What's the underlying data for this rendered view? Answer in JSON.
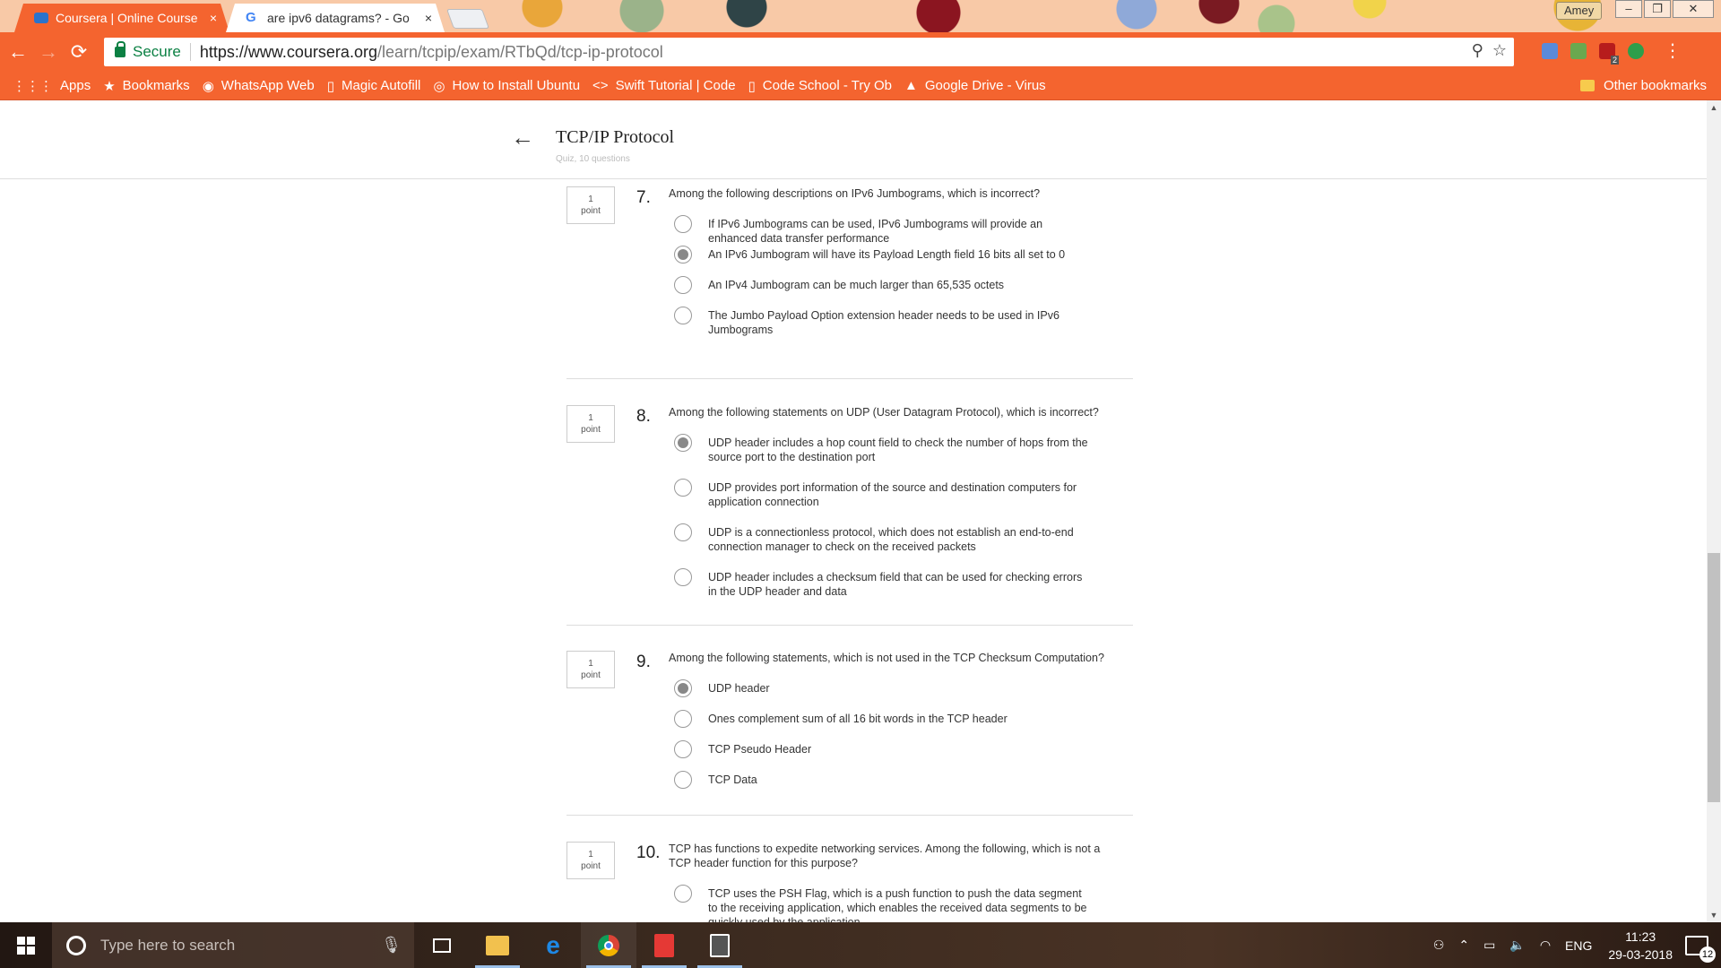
{
  "browser": {
    "tabs": [
      {
        "title": "Coursera | Online Course",
        "close": "×"
      },
      {
        "title": "are ipv6 datagrams? - Go",
        "close": "×",
        "favicon": "G"
      }
    ],
    "profile": "Amey",
    "window_buttons": {
      "minimize": "–",
      "maximize": "❐",
      "close": "✕"
    },
    "nav": {
      "back": "←",
      "forward": "→",
      "reload": "⟳"
    },
    "secure_label": "Secure",
    "url_host": "https://www.coursera.org",
    "url_path": "/learn/tcpip/exam/RTbQd/tcp-ip-protocol",
    "omni_icons": {
      "zoom": "⚲",
      "star": "☆"
    },
    "menu": "⋮",
    "ext_badge": "2",
    "bookmarks": [
      {
        "label": "Apps",
        "icon": "⋮⋮⋮"
      },
      {
        "label": "Bookmarks",
        "icon": "★"
      },
      {
        "label": "WhatsApp Web",
        "icon": "◉"
      },
      {
        "label": "Magic Autofill",
        "icon": "▯"
      },
      {
        "label": "How to Install Ubuntu",
        "icon": "◎"
      },
      {
        "label": "Swift Tutorial | Code",
        "icon": "<>"
      },
      {
        "label": "Code School - Try Ob",
        "icon": "▯"
      },
      {
        "label": "Google Drive - Virus",
        "icon": "▲"
      }
    ],
    "other_bookmarks": "Other bookmarks"
  },
  "page": {
    "back_icon": "←",
    "title": "TCP/IP Protocol",
    "subtitle": "Quiz, 10 questions",
    "questions": [
      {
        "points": [
          "1",
          "point"
        ],
        "number": "7.",
        "text": "Among the following descriptions on IPv6 Jumbograms, which is incorrect?",
        "options": [
          {
            "text": "If IPv6 Jumbograms can be used, IPv6 Jumbograms will provide an enhanced data transfer performance",
            "checked": false
          },
          {
            "text": "An IPv6 Jumbogram will have its Payload Length field 16 bits all set to 0",
            "checked": true
          },
          {
            "text": "An IPv4 Jumbogram can be much larger than 65,535 octets",
            "checked": false
          },
          {
            "text": "The Jumbo Payload Option extension header needs to be used in IPv6 Jumbograms",
            "checked": false
          }
        ]
      },
      {
        "points": [
          "1",
          "point"
        ],
        "number": "8.",
        "text": "Among the following statements on UDP (User Datagram Protocol), which is incorrect?",
        "options": [
          {
            "text": "UDP header includes a hop count field to check the number of hops from the source port to the destination port",
            "checked": true
          },
          {
            "text": "UDP provides port information of the source and destination computers for application connection",
            "checked": false
          },
          {
            "text": "UDP is a connectionless protocol, which does not establish an end-to-end connection manager to check on the received packets",
            "checked": false
          },
          {
            "text": "UDP header includes a checksum field that can be used for checking errors in the UDP header and data",
            "checked": false
          }
        ]
      },
      {
        "points": [
          "1",
          "point"
        ],
        "number": "9.",
        "text": "Among the following statements, which is not used in the TCP Checksum Computation?",
        "options": [
          {
            "text": "UDP header",
            "checked": true
          },
          {
            "text": "Ones complement sum of all 16 bit words in the TCP header",
            "checked": false
          },
          {
            "text": "TCP Pseudo Header",
            "checked": false
          },
          {
            "text": "TCP Data",
            "checked": false
          }
        ]
      },
      {
        "points": [
          "1",
          "point"
        ],
        "number": "10.",
        "text": "TCP has functions to expedite networking services. Among the following, which is not a TCP header function for this purpose?",
        "options": [
          {
            "text": "TCP uses the PSH Flag, which is a push function to push the data segment to the receiving application, which enables the received data segments to be quickly used by the application",
            "checked": false
          }
        ]
      }
    ]
  },
  "taskbar": {
    "search_placeholder": "Type here to search",
    "tray": {
      "lang": "ENG",
      "time": "11:23",
      "date": "29-03-2018",
      "notifications": "12"
    },
    "colors": {
      "explorer": "#f2c14e",
      "edge": "#1e88e5",
      "chrome": "#4caf50",
      "acrobat": "#e53935",
      "calculator": "#555555"
    }
  }
}
